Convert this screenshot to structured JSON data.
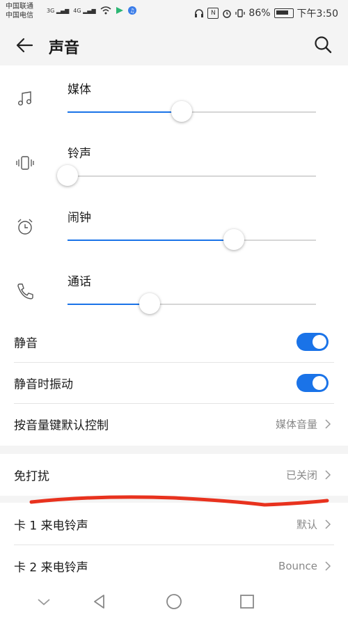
{
  "status_bar": {
    "carrier_1": "中国联通",
    "carrier_2": "中国电信",
    "net_1": "3G",
    "net_2": "4G",
    "battery": "86%",
    "time": "下午3:50"
  },
  "header": {
    "title": "声音",
    "back_icon": "arrow-left-icon",
    "search_icon": "search-icon"
  },
  "volume": {
    "media": {
      "label": "媒体",
      "level": 0.46,
      "icon": "music-note-icon"
    },
    "ringtone": {
      "label": "铃声",
      "level": 0.0,
      "icon": "vibrate-icon"
    },
    "alarm": {
      "label": "闹钟",
      "level": 0.67,
      "icon": "alarm-clock-icon"
    },
    "call": {
      "label": "通话",
      "level": 0.33,
      "icon": "phone-icon"
    }
  },
  "settings": {
    "mute": {
      "label": "静音",
      "on": true
    },
    "vibrate_on_mute": {
      "label": "静音时振动",
      "on": true
    },
    "volume_key": {
      "label": "按音量键默认控制",
      "value": "媒体音量"
    },
    "dnd": {
      "label": "免打扰",
      "value": "已关闭"
    },
    "sim1_ringtone": {
      "label": "卡 1 来电铃声",
      "value": "默认"
    },
    "sim2_ringtone": {
      "label": "卡 2 来电铃声",
      "value": "Bounce"
    }
  },
  "colors": {
    "accent": "#1a73e8",
    "annotation": "#e8321e"
  },
  "nav_bar": [
    "chevron-down-icon",
    "back-triangle-icon",
    "home-circle-icon",
    "recents-square-icon"
  ]
}
